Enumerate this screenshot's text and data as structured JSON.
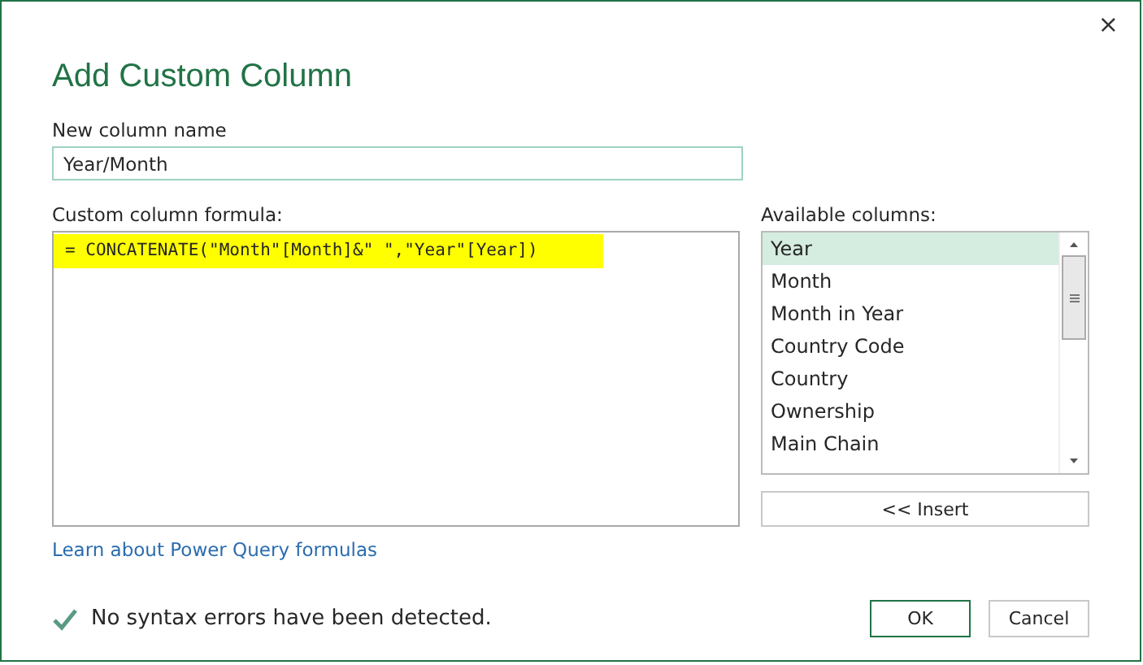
{
  "dialog": {
    "close": "×",
    "title": "Add Custom Column"
  },
  "name_field": {
    "label": "New column name",
    "value": "Year/Month"
  },
  "formula": {
    "label": "Custom column formula:",
    "value": "= CONCATENATE(\"Month\"[Month]&\" \",\"Year\"[Year])",
    "highlighted": true
  },
  "available_columns": {
    "label": "Available columns:",
    "items": [
      {
        "label": "Year",
        "selected": true
      },
      {
        "label": "Month",
        "selected": false
      },
      {
        "label": "Month in Year",
        "selected": false
      },
      {
        "label": "Country Code",
        "selected": false
      },
      {
        "label": "Country",
        "selected": false
      },
      {
        "label": "Ownership",
        "selected": false
      },
      {
        "label": "Main Chain",
        "selected": false
      }
    ],
    "insert_button": "<< Insert"
  },
  "link": "Learn about Power Query formulas",
  "status": "No syntax errors have been detected.",
  "buttons": [
    {
      "label": "OK",
      "kind": "primary"
    },
    {
      "label": "Cancel",
      "kind": "secondary"
    }
  ]
}
